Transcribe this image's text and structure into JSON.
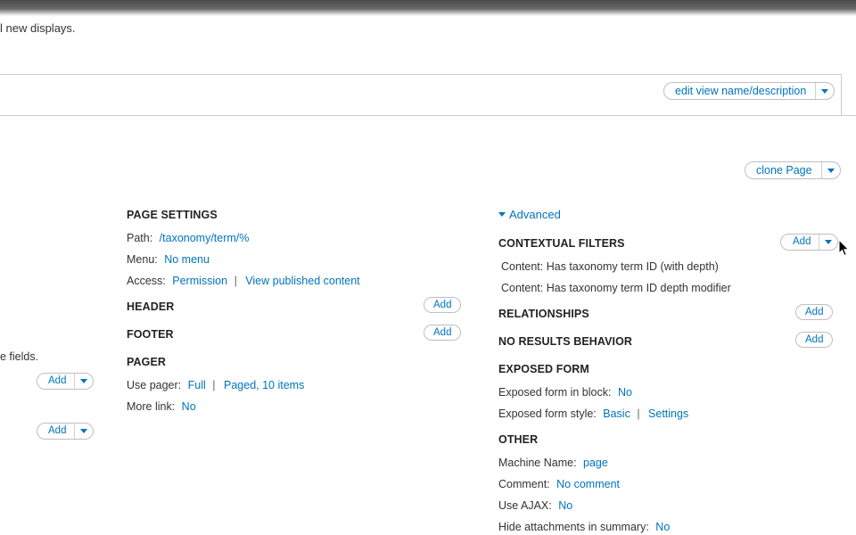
{
  "intro_text": "l new displays.",
  "top_actions": {
    "edit_view_label": "edit view name/description"
  },
  "display_actions": {
    "clone_label": "clone Page"
  },
  "left_column": {
    "partial_text": "e fields.",
    "add1_label": "Add",
    "add2_label": "Add"
  },
  "page_settings": {
    "heading": "PAGE SETTINGS",
    "path_label": "Path:",
    "path_value": "/taxonomy/term/%",
    "menu_label": "Menu:",
    "menu_value": "No menu",
    "access_label": "Access:",
    "access_value1": "Permission",
    "access_value2": "View published content"
  },
  "header": {
    "heading": "HEADER",
    "add_label": "Add"
  },
  "footer": {
    "heading": "FOOTER",
    "add_label": "Add"
  },
  "pager": {
    "heading": "PAGER",
    "use_pager_label": "Use pager:",
    "use_pager_value1": "Full",
    "use_pager_value2": "Paged, 10 items",
    "more_link_label": "More link:",
    "more_link_value": "No"
  },
  "advanced": {
    "toggle_label": "Advanced",
    "contextual_filters": {
      "heading": "CONTEXTUAL FILTERS",
      "add_label": "Add",
      "items": [
        "Content: Has taxonomy term ID (with depth)",
        "Content: Has taxonomy term ID depth modifier"
      ]
    },
    "relationships": {
      "heading": "RELATIONSHIPS",
      "add_label": "Add"
    },
    "no_results": {
      "heading": "NO RESULTS BEHAVIOR",
      "add_label": "Add"
    },
    "exposed_form": {
      "heading": "EXPOSED FORM",
      "in_block_label": "Exposed form in block:",
      "in_block_value": "No",
      "style_label": "Exposed form style:",
      "style_value1": "Basic",
      "style_value2": "Settings"
    },
    "other": {
      "heading": "OTHER",
      "machine_name_label": "Machine Name:",
      "machine_name_value": "page",
      "comment_label": "Comment:",
      "comment_value": "No comment",
      "ajax_label": "Use AJAX:",
      "ajax_value": "No",
      "hide_attach_label": "Hide attachments in summary:",
      "hide_attach_value": "No"
    }
  },
  "icons": {
    "dropdown": "chevron-down-icon",
    "advanced_toggle": "triangle-down-icon",
    "cursor": "mouse-pointer-icon"
  },
  "colors": {
    "link": "#0074bd",
    "border": "#cccccc",
    "heading": "#222222"
  }
}
